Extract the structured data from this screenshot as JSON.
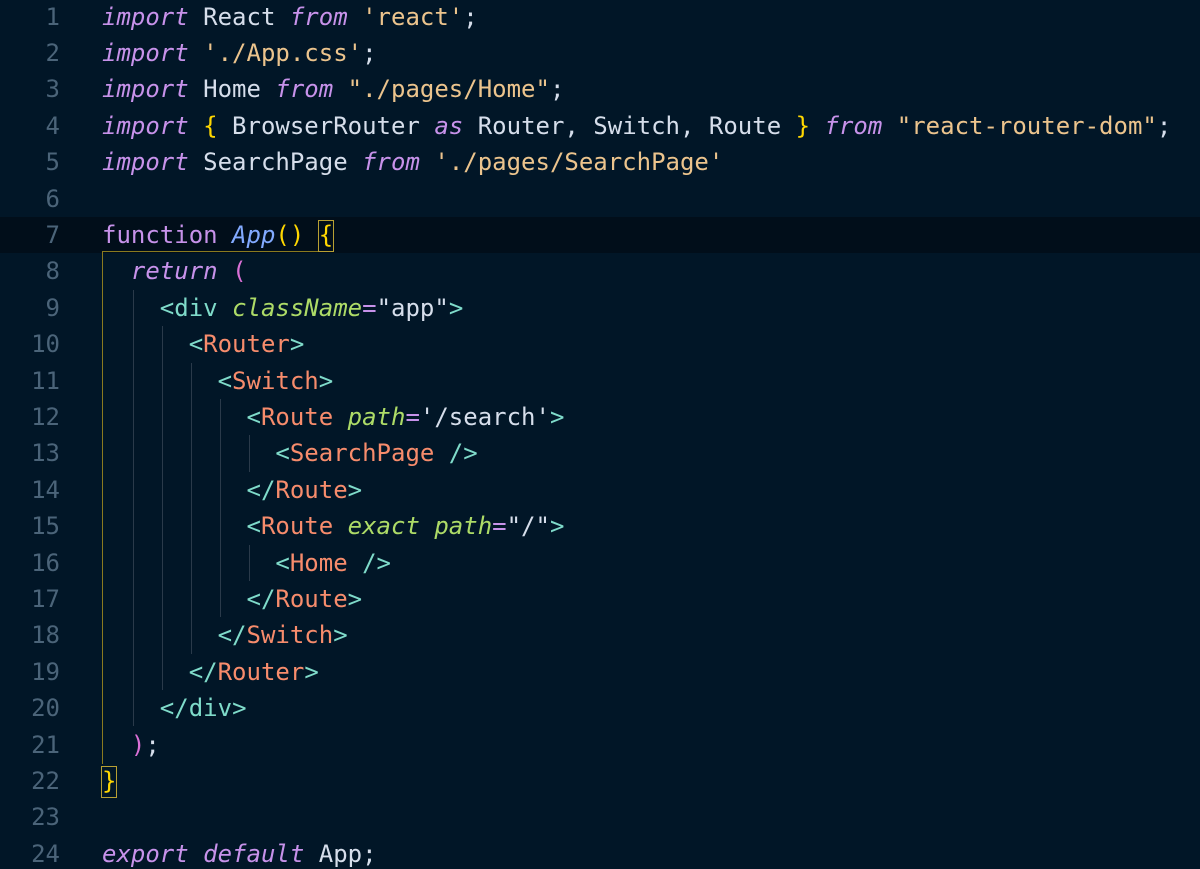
{
  "editor": {
    "theme_colors": {
      "background": "#011627",
      "line_number": "#4b6479",
      "keyword": "#c792ea",
      "string": "#ecc48d",
      "tag": "#f78c6c",
      "attribute": "#addb67",
      "punctuation": "#7fdbca",
      "brace": "#ffd700"
    },
    "lines": [
      {
        "n": "1",
        "tokens": [
          [
            "kw",
            "import"
          ],
          [
            "plain",
            " React "
          ],
          [
            "kw",
            "from"
          ],
          [
            "plain",
            " "
          ],
          [
            "str",
            "'react'"
          ],
          [
            "plain",
            ";"
          ]
        ]
      },
      {
        "n": "2",
        "tokens": [
          [
            "kw",
            "import"
          ],
          [
            "plain",
            " "
          ],
          [
            "str",
            "'./App.css'"
          ],
          [
            "plain",
            ";"
          ]
        ]
      },
      {
        "n": "3",
        "tokens": [
          [
            "kw",
            "import"
          ],
          [
            "plain",
            " Home "
          ],
          [
            "kw",
            "from"
          ],
          [
            "plain",
            " "
          ],
          [
            "str",
            "\"./pages/Home\""
          ],
          [
            "plain",
            ";"
          ]
        ]
      },
      {
        "n": "4",
        "tokens": [
          [
            "kw",
            "import"
          ],
          [
            "plain",
            " "
          ],
          [
            "brace",
            "{"
          ],
          [
            "plain",
            " BrowserRouter "
          ],
          [
            "kw",
            "as"
          ],
          [
            "plain",
            " Router, Switch, Route "
          ],
          [
            "brace",
            "}"
          ],
          [
            "plain",
            " "
          ],
          [
            "kw",
            "from"
          ],
          [
            "plain",
            " "
          ],
          [
            "str",
            "\"react-router-dom\""
          ],
          [
            "plain",
            ";"
          ]
        ]
      },
      {
        "n": "5",
        "tokens": [
          [
            "kw",
            "import"
          ],
          [
            "plain",
            " SearchPage "
          ],
          [
            "kw",
            "from"
          ],
          [
            "plain",
            " "
          ],
          [
            "str",
            "'./pages/SearchPage'"
          ]
        ]
      },
      {
        "n": "6",
        "tokens": []
      },
      {
        "n": "7",
        "tokens": [
          [
            "fn",
            "function"
          ],
          [
            "plain",
            " "
          ],
          [
            "fnname",
            "App"
          ],
          [
            "paren",
            "()"
          ],
          [
            "plain",
            " "
          ],
          [
            "brace",
            "{"
          ]
        ]
      },
      {
        "n": "8",
        "tokens": [
          [
            "plain",
            "  "
          ],
          [
            "kw",
            "return"
          ],
          [
            "plain",
            " "
          ],
          [
            "rparen",
            "("
          ]
        ]
      },
      {
        "n": "9",
        "tokens": [
          [
            "plain",
            "    "
          ],
          [
            "tagpunct",
            "<"
          ],
          [
            "htmltag",
            "div"
          ],
          [
            "plain",
            " "
          ],
          [
            "attr",
            "className"
          ],
          [
            "eq",
            "="
          ],
          [
            "plain",
            "\"app\""
          ],
          [
            "tagpunct",
            ">"
          ]
        ]
      },
      {
        "n": "10",
        "tokens": [
          [
            "plain",
            "      "
          ],
          [
            "tagpunct",
            "<"
          ],
          [
            "tag",
            "Router"
          ],
          [
            "tagpunct",
            ">"
          ]
        ]
      },
      {
        "n": "11",
        "tokens": [
          [
            "plain",
            "        "
          ],
          [
            "tagpunct",
            "<"
          ],
          [
            "tag",
            "Switch"
          ],
          [
            "tagpunct",
            ">"
          ]
        ]
      },
      {
        "n": "12",
        "tokens": [
          [
            "plain",
            "          "
          ],
          [
            "tagpunct",
            "<"
          ],
          [
            "tag",
            "Route"
          ],
          [
            "plain",
            " "
          ],
          [
            "attr",
            "path"
          ],
          [
            "eq",
            "="
          ],
          [
            "plain",
            "'/search'"
          ],
          [
            "tagpunct",
            ">"
          ]
        ]
      },
      {
        "n": "13",
        "tokens": [
          [
            "plain",
            "            "
          ],
          [
            "tagpunct",
            "<"
          ],
          [
            "tag",
            "SearchPage"
          ],
          [
            "plain",
            " "
          ],
          [
            "tagpunct",
            "/>"
          ]
        ]
      },
      {
        "n": "14",
        "tokens": [
          [
            "plain",
            "          "
          ],
          [
            "tagpunct",
            "</"
          ],
          [
            "tag",
            "Route"
          ],
          [
            "tagpunct",
            ">"
          ]
        ]
      },
      {
        "n": "15",
        "tokens": [
          [
            "plain",
            "          "
          ],
          [
            "tagpunct",
            "<"
          ],
          [
            "tag",
            "Route"
          ],
          [
            "plain",
            " "
          ],
          [
            "attr",
            "exact"
          ],
          [
            "plain",
            " "
          ],
          [
            "attr",
            "path"
          ],
          [
            "eq",
            "="
          ],
          [
            "plain",
            "\"/\""
          ],
          [
            "tagpunct",
            ">"
          ]
        ]
      },
      {
        "n": "16",
        "tokens": [
          [
            "plain",
            "            "
          ],
          [
            "tagpunct",
            "<"
          ],
          [
            "tag",
            "Home"
          ],
          [
            "plain",
            " "
          ],
          [
            "tagpunct",
            "/>"
          ]
        ]
      },
      {
        "n": "17",
        "tokens": [
          [
            "plain",
            "          "
          ],
          [
            "tagpunct",
            "</"
          ],
          [
            "tag",
            "Route"
          ],
          [
            "tagpunct",
            ">"
          ]
        ]
      },
      {
        "n": "18",
        "tokens": [
          [
            "plain",
            "        "
          ],
          [
            "tagpunct",
            "</"
          ],
          [
            "tag",
            "Switch"
          ],
          [
            "tagpunct",
            ">"
          ]
        ]
      },
      {
        "n": "19",
        "tokens": [
          [
            "plain",
            "      "
          ],
          [
            "tagpunct",
            "</"
          ],
          [
            "tag",
            "Router"
          ],
          [
            "tagpunct",
            ">"
          ]
        ]
      },
      {
        "n": "20",
        "tokens": [
          [
            "plain",
            "    "
          ],
          [
            "tagpunct",
            "</"
          ],
          [
            "htmltag",
            "div"
          ],
          [
            "tagpunct",
            ">"
          ]
        ]
      },
      {
        "n": "21",
        "tokens": [
          [
            "plain",
            "  "
          ],
          [
            "rparen",
            ")"
          ],
          [
            "plain",
            ";"
          ]
        ]
      },
      {
        "n": "22",
        "tokens": [
          [
            "brace",
            "}"
          ]
        ]
      },
      {
        "n": "23",
        "tokens": []
      },
      {
        "n": "24",
        "tokens": [
          [
            "kw",
            "export"
          ],
          [
            "plain",
            " "
          ],
          [
            "kw",
            "default"
          ],
          [
            "plain",
            " App;"
          ]
        ]
      }
    ]
  }
}
